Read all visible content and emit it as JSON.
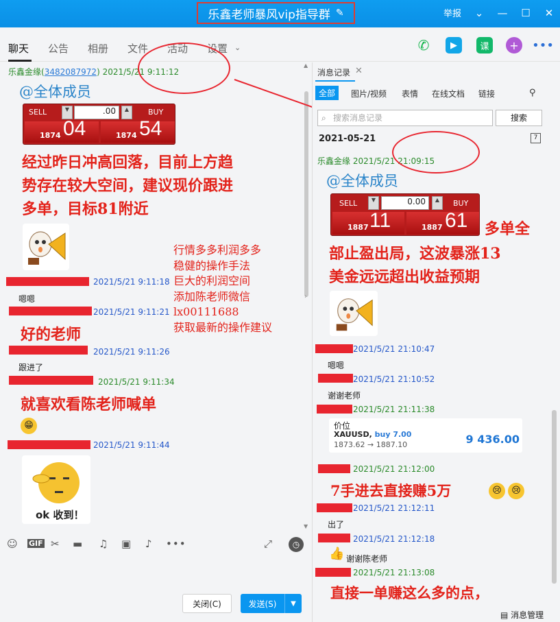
{
  "window": {
    "title": "乐鑫老师暴风vip指导群",
    "report": "举报",
    "brand_color": "#0a96f0"
  },
  "tabs": [
    {
      "label": "聊天"
    },
    {
      "label": "公告"
    },
    {
      "label": "相册"
    },
    {
      "label": "文件"
    },
    {
      "label": "活动"
    },
    {
      "label": "设置"
    }
  ],
  "header_icons": {
    "lesson": "课"
  },
  "chat": {
    "msg1": {
      "name": "乐鑫金缘",
      "uid": "3482087972",
      "time": "2021/5/21 9:11:12"
    },
    "mention": "@全体成员",
    "trade1": {
      "sell": "SELL",
      "buy": "BUY",
      "amount": ".00",
      "sell_small": "1874",
      "sell_big": "04",
      "buy_small": "1874",
      "buy_big": "54"
    },
    "advice": [
      "经过昨日冲高回落，目前上方趋",
      "势存在较大空间，建议现价跟进",
      "多单，目标81附近"
    ],
    "promo": [
      "行情多多利润多多",
      "稳健的操作手法",
      "巨大的利润空间",
      "添加陈老师微信",
      "lx00111688",
      "获取最新的操作建议"
    ],
    "t2": "2021/5/21 9:11:18",
    "m2": "嗯嗯",
    "t3": "2021/5/21 9:11:21",
    "m3": "好的老师",
    "t4": "2021/5/21 9:11:26",
    "m4": "跟进了",
    "t5": "2021/5/21 9:11:34",
    "m5": "就喜欢看陈老师喊单",
    "t6": "2021/5/21 9:11:44",
    "sticker_caption": "ok 收到！"
  },
  "input": {
    "close": "关闭(C)",
    "send": "发送(S)"
  },
  "history": {
    "title": "消息记录",
    "filters": [
      "全部",
      "图片/视频",
      "表情",
      "在线文档",
      "链接"
    ],
    "search_placeholder": "搜索消息记录",
    "search_button": "搜索",
    "date": "2021-05-21",
    "r1": {
      "name": "乐鑫金缘",
      "time": "2021/5/21 21:09:15"
    },
    "mention": "@全体成员",
    "trade2": {
      "sell": "SELL",
      "buy": "BUY",
      "amount": "0.00",
      "sell_small": "1887",
      "sell_big": "11",
      "buy_small": "1887",
      "buy_big": "61"
    },
    "profit": [
      "多单全",
      "部止盈出局，这波暴涨13",
      "美金远远超出收益预期"
    ],
    "t2": "2021/5/21 21:10:47",
    "m2": "嗯嗯",
    "t3": "2021/5/21 21:10:52",
    "m3": "谢谢老师",
    "t4": "2021/5/21 21:11:38",
    "price_card": {
      "title": "价位",
      "symbol": "XAUUSD,",
      "action": "buy 7.00",
      "range": "1873.62 → 1887.10",
      "value": "9 436.00"
    },
    "t5": "2021/5/21 21:12:00",
    "m5": "7手进去直接赚5万",
    "t6": "2021/5/21 21:12:11",
    "m6": "出了",
    "t7": "2021/5/21 21:12:18",
    "m7": "谢谢陈老师",
    "t8": "2021/5/21 21:13:08",
    "m8": "直接一单赚这么多的点，",
    "manage": "消息管理"
  }
}
